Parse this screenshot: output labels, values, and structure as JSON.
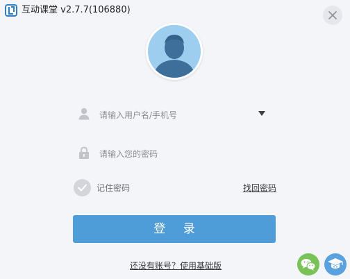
{
  "app": {
    "title": "互动课堂 v2.7.7(106880)"
  },
  "login": {
    "username_placeholder": "请输入用户名/手机号",
    "password_placeholder": "请输入您的密码",
    "remember_label": "记住密码",
    "find_password_label": "找回密码",
    "login_button_label": "登 录",
    "basic_version_link": "还没有账号？使用基础版"
  },
  "icons": {
    "app_logo": "app-logo-icon",
    "close": "close-icon",
    "avatar": "user-avatar-icon",
    "username": "user-icon",
    "password": "lock-icon",
    "dropdown": "caret-down-icon",
    "remember": "check-icon",
    "wechat": "wechat-icon",
    "edu": "graduation-cap-icon"
  },
  "colors": {
    "background": "#f4f5f9",
    "primary": "#4f9dd8",
    "wechat_green": "#79c258",
    "edu_blue": "#5aa2df",
    "avatar_bg": "#9dcef0",
    "avatar_figure": "#3e6e9a"
  }
}
